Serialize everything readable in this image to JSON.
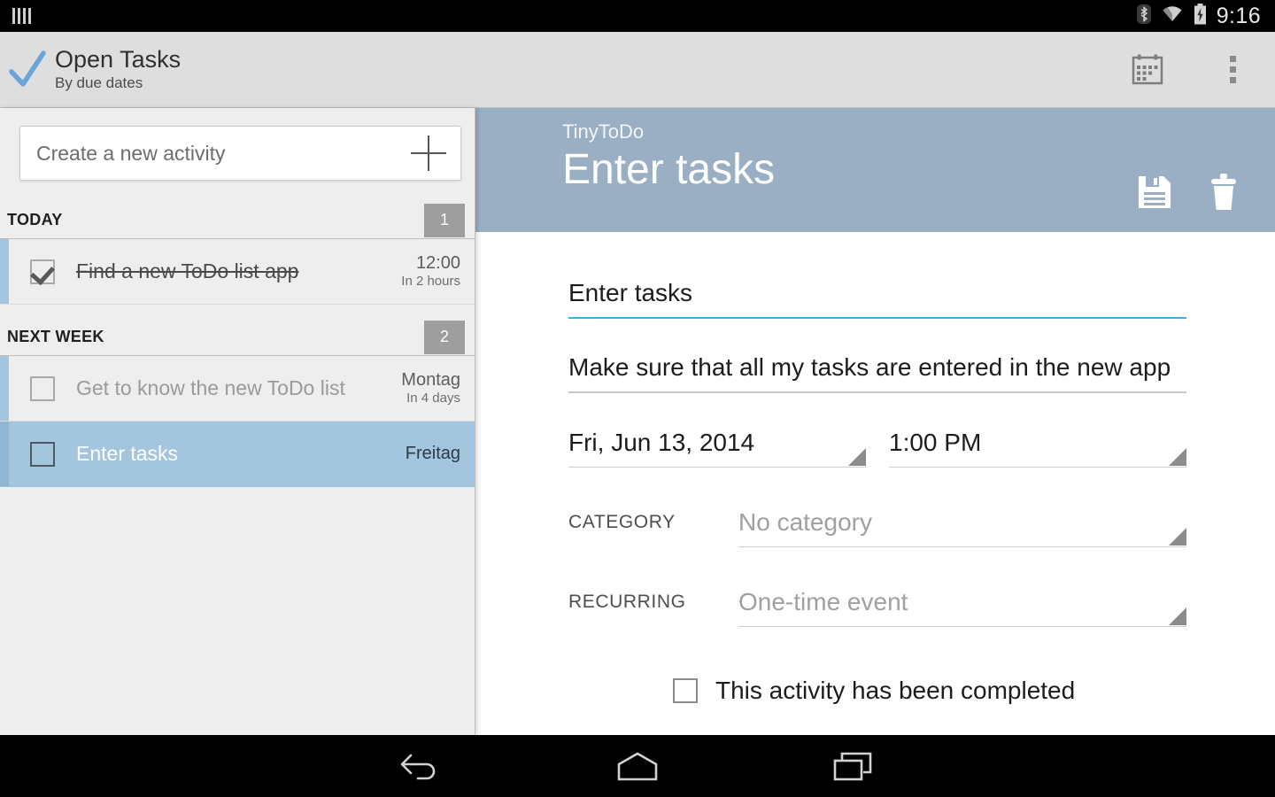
{
  "statusbar": {
    "time": "9:16",
    "icons": [
      "bluetooth-icon",
      "wifi-icon",
      "battery-charging-icon"
    ]
  },
  "actionbar": {
    "logo": "checkmark-logo",
    "title": "Open Tasks",
    "subtitle": "By due dates",
    "calendar_label": "calendar-icon",
    "overflow_label": "overflow-menu-icon"
  },
  "list_panel": {
    "new_activity_placeholder": "Create a new activity",
    "add_label": "+",
    "sections": [
      {
        "label": "TODAY",
        "count": "1",
        "rows": [
          {
            "title": "Find a new ToDo list app",
            "when": "12:00",
            "relative": "In 2 hours",
            "checked": true,
            "selected": false
          }
        ]
      },
      {
        "label": "NEXT WEEK",
        "count": "2",
        "rows": [
          {
            "title": "Get to know the new ToDo list",
            "when": "Montag",
            "relative": "In 4 days",
            "checked": false,
            "selected": false
          },
          {
            "title": "Enter tasks",
            "when": "Freitag",
            "relative": "",
            "checked": false,
            "selected": true
          }
        ]
      }
    ]
  },
  "detail": {
    "app_name": "TinyToDo",
    "title": "Enter tasks",
    "save_label": "save-icon",
    "delete_label": "delete-icon",
    "fields": {
      "title_value": "Enter tasks",
      "description_value": "Make sure that all my tasks are entered in the new app",
      "date_value": "Fri, Jun 13, 2014",
      "time_value": "1:00 PM",
      "category_label": "CATEGORY",
      "category_value": "No category",
      "recurring_label": "RECURRING",
      "recurring_value": "One-time event",
      "completed_label": "This activity has been completed",
      "completed_checked": false
    }
  },
  "navbar": {
    "back_label": "back-icon",
    "home_label": "home-icon",
    "recents_label": "recents-icon"
  },
  "colors": {
    "accent_blue": "#33b5e5",
    "header_blue": "#9aafc4",
    "selected_row": "#a4c5de",
    "logo_blue": "#6ba4d8",
    "badge_grey": "#9e9e9e",
    "panel_bg": "#eeeeee",
    "actionbar_bg": "#dedede"
  }
}
